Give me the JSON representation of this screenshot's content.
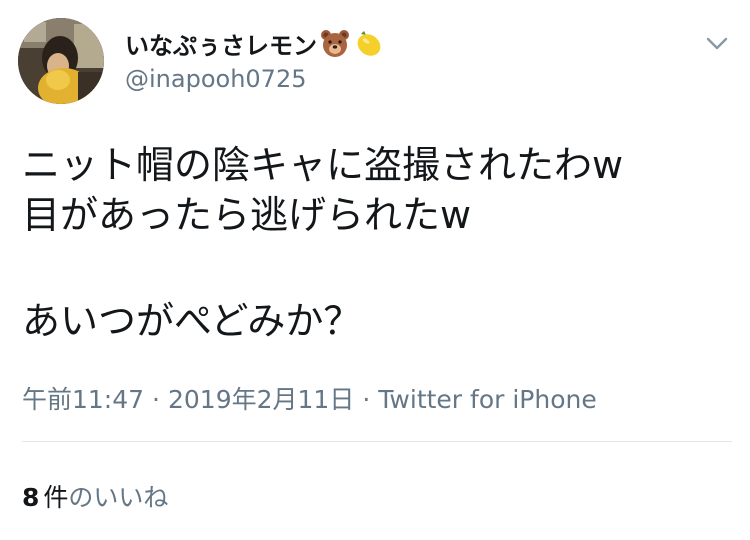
{
  "header": {
    "display_name": "いなぷぅさレモン",
    "handle": "@inapooh0725",
    "name_emojis": [
      "bear-face-icon",
      "lemon-icon"
    ],
    "more_icon": "chevron-down-icon"
  },
  "tweet": {
    "lines": [
      "ニット帽の陰キャに盗撮されたわw",
      "目があったら逃げられたw",
      "あいつがぺどみか？"
    ]
  },
  "meta": {
    "time": "午前11:47",
    "separator": "·",
    "date": "2019年2月11日",
    "source": "Twitter for iPhone"
  },
  "likes": {
    "count": "8",
    "unit": "件",
    "label": "のいいね"
  },
  "colors": {
    "text": "#14171a",
    "secondary": "#657786",
    "divider": "#e1e8ed"
  }
}
